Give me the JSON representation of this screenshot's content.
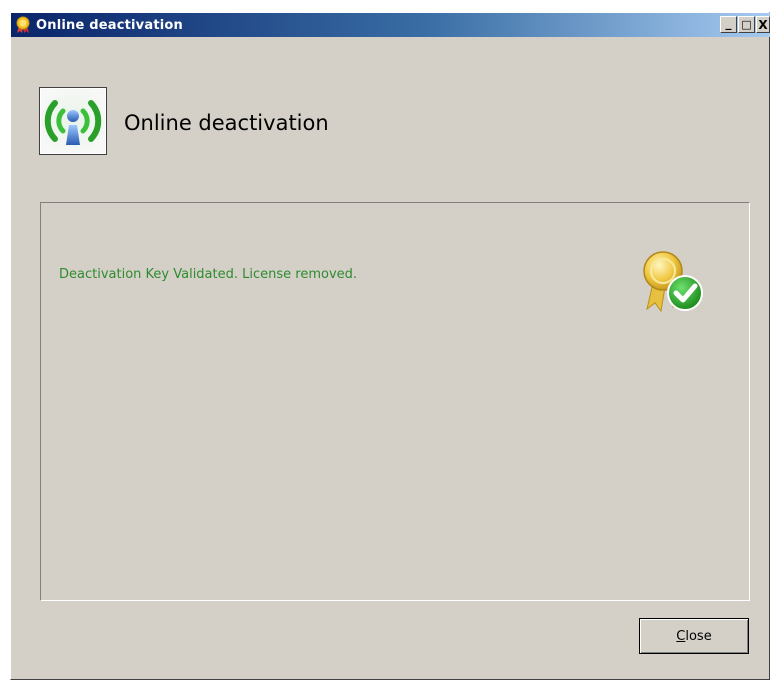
{
  "window": {
    "title": "Online deactivation",
    "icon": "award-ribbon-icon",
    "controls": {
      "minimize": "_",
      "maximize": "□",
      "close": "X"
    }
  },
  "header": {
    "icon": "wireless-user-icon",
    "title": "Online deactivation"
  },
  "panel": {
    "status_text": "Deactivation Key Validated.  License removed.",
    "status_color": "#2e8b2e",
    "status_icon": "certificate-check-icon"
  },
  "footer": {
    "close_label_first": "C",
    "close_label_rest": "lose"
  }
}
